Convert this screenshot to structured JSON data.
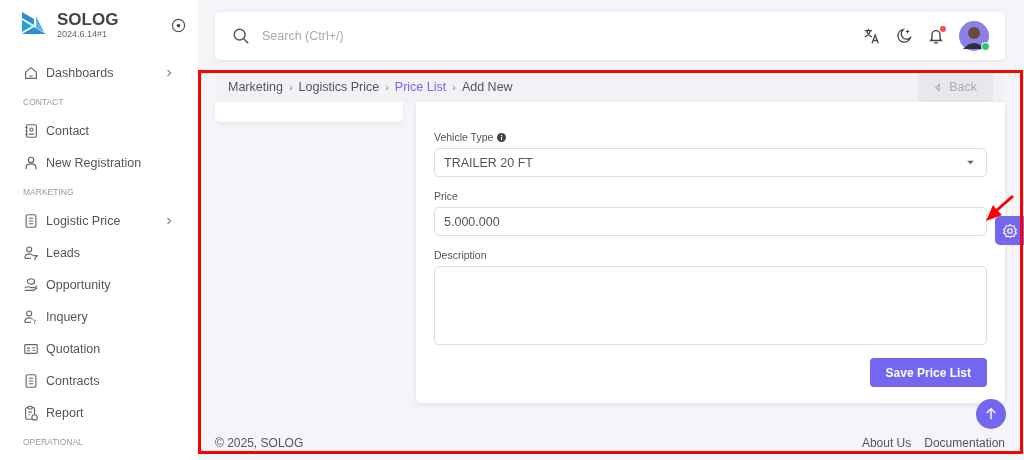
{
  "brand": {
    "name": "SOLOG",
    "version": "2024.6.14#1"
  },
  "sidebar": [
    {
      "kind": "item",
      "label": "Dashboards",
      "expandable": true
    },
    {
      "kind": "section",
      "label": "CONTACT"
    },
    {
      "kind": "item",
      "label": "Contact",
      "expandable": false
    },
    {
      "kind": "item",
      "label": "New Registration",
      "expandable": false
    },
    {
      "kind": "section",
      "label": "MARKETING"
    },
    {
      "kind": "item",
      "label": "Logistic Price",
      "expandable": true
    },
    {
      "kind": "item",
      "label": "Leads",
      "expandable": false
    },
    {
      "kind": "item",
      "label": "Opportunity",
      "expandable": false
    },
    {
      "kind": "item",
      "label": "Inquery",
      "expandable": false
    },
    {
      "kind": "item",
      "label": "Quotation",
      "expandable": false
    },
    {
      "kind": "item",
      "label": "Contracts",
      "expandable": false
    },
    {
      "kind": "item",
      "label": "Report",
      "expandable": false
    },
    {
      "kind": "section",
      "label": "OPERATIONAL"
    }
  ],
  "navbar": {
    "search_placeholder": "Search (Ctrl+/)",
    "notifications_unread": true,
    "user_online": true
  },
  "breadcrumb_separator": "›",
  "breadcrumb": [
    {
      "label": "Marketing",
      "link": false
    },
    {
      "label": "Logistics Price",
      "link": false
    },
    {
      "label": "Price List",
      "link": true
    },
    {
      "label": "Add New",
      "link": false
    }
  ],
  "back_button": {
    "label": "Back",
    "disabled": true
  },
  "form": {
    "fields": [
      {
        "kind": "select",
        "label": "Vehicle Type",
        "info": true,
        "value": "TRAILER 20 FT"
      },
      {
        "kind": "input",
        "label": "Price",
        "info": false,
        "value": "5.000.000"
      },
      {
        "kind": "textarea",
        "label": "Description",
        "info": false
      }
    ],
    "submit": "Save Price List"
  },
  "footer": {
    "copyright": "© 2025, SOLOG",
    "links": [
      "About Us",
      "Documentation"
    ]
  }
}
